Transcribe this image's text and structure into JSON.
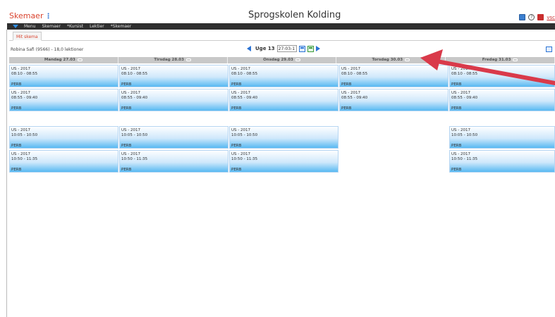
{
  "header": {
    "app_title": "Skemaer",
    "school_name": "Sprogskolen Kolding",
    "top_link": "vsc"
  },
  "menu": {
    "items": [
      "Menu",
      "Skemaer",
      "*Kursist",
      "Lektier",
      "*Skemaer"
    ]
  },
  "tabs": [
    {
      "label": "Mit skema"
    }
  ],
  "schedule": {
    "teacher_info": "Robina Safi (9566) - 18,0 lektioner",
    "week_label": "Uge 13",
    "date_value": "27-03-17",
    "days": [
      {
        "label": "Mandag 27.03"
      },
      {
        "label": "Tirsdag 28.03"
      },
      {
        "label": "Onsdag 29.03"
      },
      {
        "label": "Torsdag 30.03"
      },
      {
        "label": "Fredag 31.03"
      }
    ],
    "lessons": [
      {
        "title": "US - 2017",
        "time": "08:10 - 08:55",
        "room": "PERB"
      },
      {
        "title": "US - 2017",
        "time": "08:55 - 09:40",
        "room": "PERB"
      },
      {
        "title": "US - 2017",
        "time": "10:05 - 10:50",
        "room": "PERB"
      },
      {
        "title": "US - 2017",
        "time": "10:50 - 11:35",
        "room": "PERB"
      }
    ]
  },
  "colors": {
    "brand_red": "#d9432e",
    "accent_blue": "#2b73d4",
    "annotation_arrow": "#d93a4a",
    "menubar": "#2f2f2f"
  },
  "icons": [
    "chart-icon",
    "help-icon",
    "exit-icon",
    "calendar-icon",
    "calendar-today-icon",
    "print-icon",
    "comment-icon"
  ]
}
